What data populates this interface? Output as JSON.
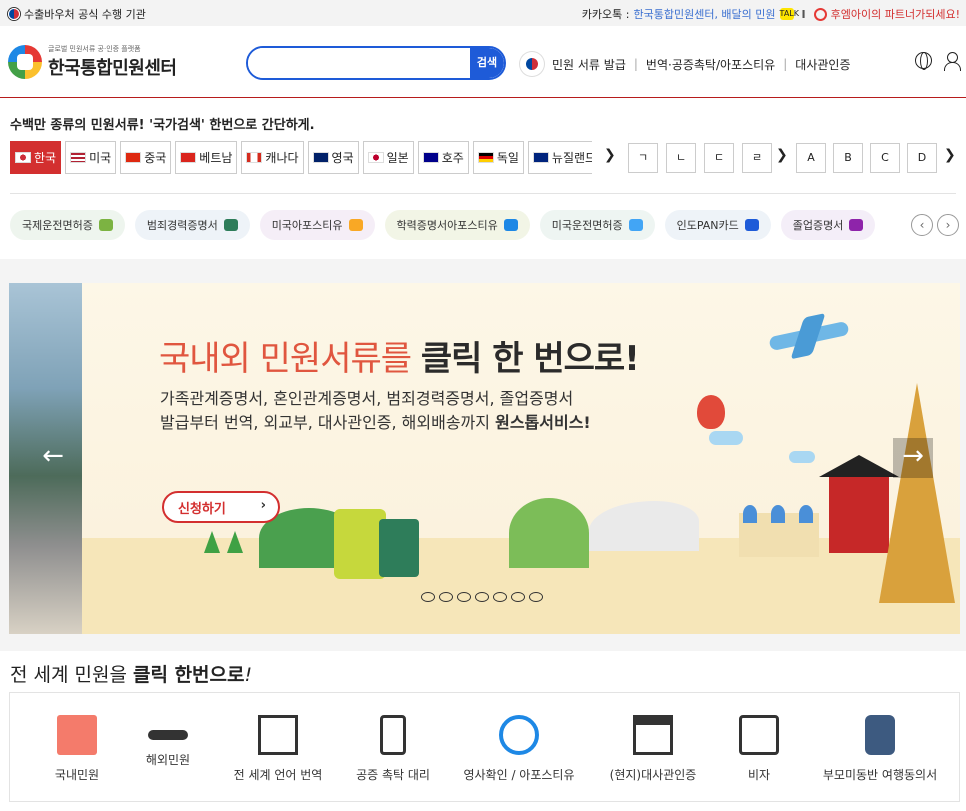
{
  "topbar": {
    "agency": "수출바우처 공식 수행 기관",
    "kakao_prefix": "카카오톡 : ",
    "kakao_link": "한국통합민원센터, 배달의 민원",
    "sponsor": "후엠아이의 파트너가되세요!"
  },
  "header": {
    "logo_sub": "글로벌 민원서류 공·인증 플랫폼",
    "logo_title": "한국통합민원센터",
    "search_placeholder": "",
    "search_button": "검색",
    "nav": [
      "민원 서류 발급",
      "번역·공증촉탁/아포스티유",
      "대사관인증"
    ]
  },
  "countries": {
    "tagline": "수백만 종류의 민원서류! '국가검색' 한번으로 간단하게.",
    "items": [
      {
        "label": "한국",
        "flag": "kr"
      },
      {
        "label": "미국",
        "flag": "us"
      },
      {
        "label": "중국",
        "flag": "cn"
      },
      {
        "label": "베트남",
        "flag": "vn"
      },
      {
        "label": "캐나다",
        "flag": "ca"
      },
      {
        "label": "영국",
        "flag": "uk"
      },
      {
        "label": "일본",
        "flag": "jp"
      },
      {
        "label": "호주",
        "flag": "au"
      },
      {
        "label": "독일",
        "flag": "de"
      },
      {
        "label": "뉴질랜드",
        "flag": "nz"
      }
    ],
    "korean_initials": [
      "ㄱ",
      "ㄴ",
      "ㄷ",
      "ㄹ"
    ],
    "latin_initials": [
      "A",
      "B",
      "C",
      "D"
    ]
  },
  "chips": [
    {
      "label": "국제운전면허증",
      "bg": "#eef5ee",
      "icon_color": "#7cb342"
    },
    {
      "label": "범죄경력증명서",
      "bg": "#eef3f8",
      "icon_color": "#2e7d5a"
    },
    {
      "label": "미국아포스티유",
      "bg": "#f5eef7",
      "icon_color": "#f9a825"
    },
    {
      "label": "학력증명서아포스티유",
      "bg": "#f2f5e6",
      "icon_color": "#1e88e5"
    },
    {
      "label": "미국운전면허증",
      "bg": "#eef5f2",
      "icon_color": "#42a5f5"
    },
    {
      "label": "인도PAN카드",
      "bg": "#eef3f8",
      "icon_color": "#1e5bd8"
    },
    {
      "label": "졸업증명서",
      "bg": "#f4eef8",
      "icon_color": "#8e24aa"
    }
  ],
  "banner": {
    "title_red": "국내외 민원서류를 ",
    "title_bold": "클릭 한 번으로!",
    "line1": "가족관계증명서, 혼인관계증명서, 범죄경력증명서, 졸업증명서",
    "line2_prefix": "발급부터 번역, 외교부, 대사관인증, 해외배송까지 ",
    "line2_bold": "원스톱서비스!",
    "apply_button": "신청하기",
    "slide_count": 7
  },
  "services": {
    "title_prefix": "전 세계 민원을 ",
    "title_bold": "클릭 한번으로",
    "title_suffix": "!",
    "items": [
      {
        "label": "국내민원",
        "icon": "folder-icon"
      },
      {
        "label": "해외민원",
        "icon": "airplane-icon"
      },
      {
        "label": "전 세계 언어 번역",
        "icon": "document-icon"
      },
      {
        "label": "공증 촉탁 대리",
        "icon": "id-badge-icon"
      },
      {
        "label": "영사확인 / 아포스티유",
        "icon": "gear-person-icon"
      },
      {
        "label": "(현지)대사관인증",
        "icon": "embassy-icon"
      },
      {
        "label": "비자",
        "icon": "visa-globe-icon"
      },
      {
        "label": "부모미동반 여행동의서",
        "icon": "traveler-icon"
      }
    ]
  },
  "colors": {
    "brand_red": "#d32f2f",
    "search_blue": "#1e5bd8"
  }
}
